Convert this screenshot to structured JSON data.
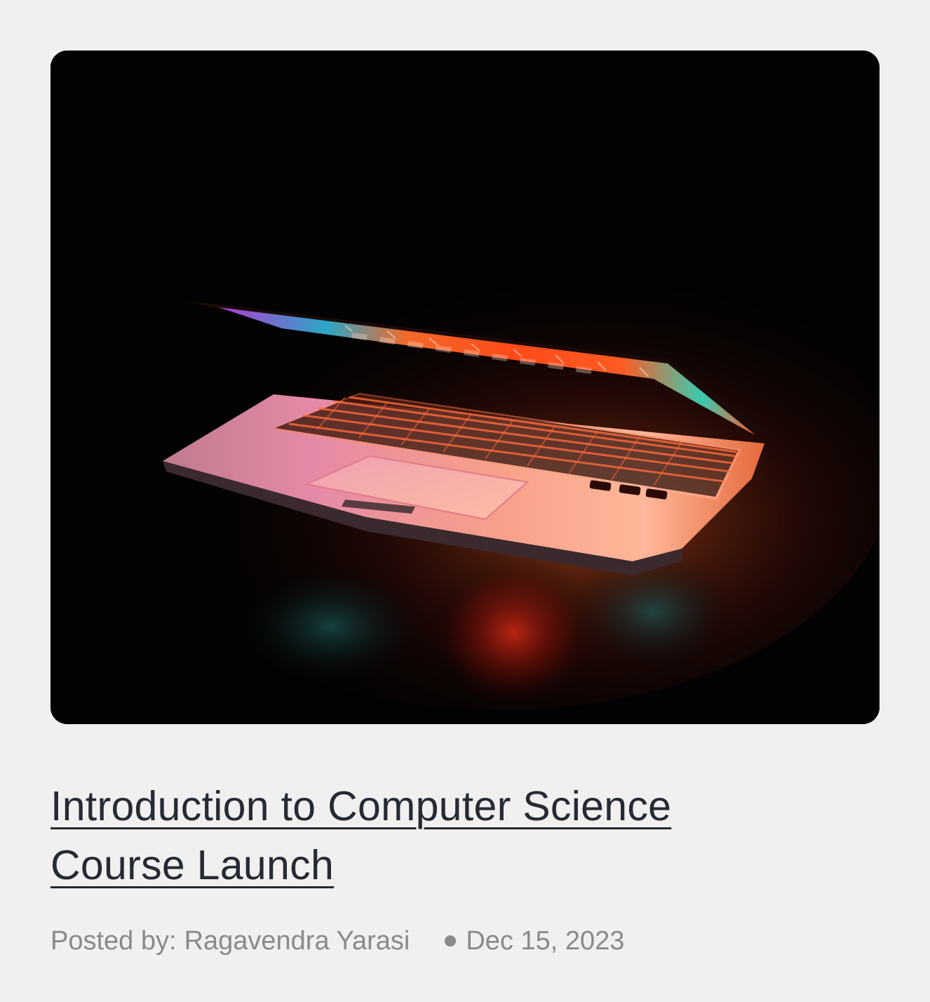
{
  "post": {
    "image_alt": "Laptop glowing in the dark",
    "title": "Introduction to Computer Science Course Launch",
    "posted_by_label": "Posted by:",
    "author": "Ragavendra Yarasi",
    "date": "Dec 15, 2023"
  },
  "colors": {
    "background": "#f0f0f0",
    "title": "#262a33",
    "meta": "#8a8a8a",
    "image_bg": "#020202"
  }
}
